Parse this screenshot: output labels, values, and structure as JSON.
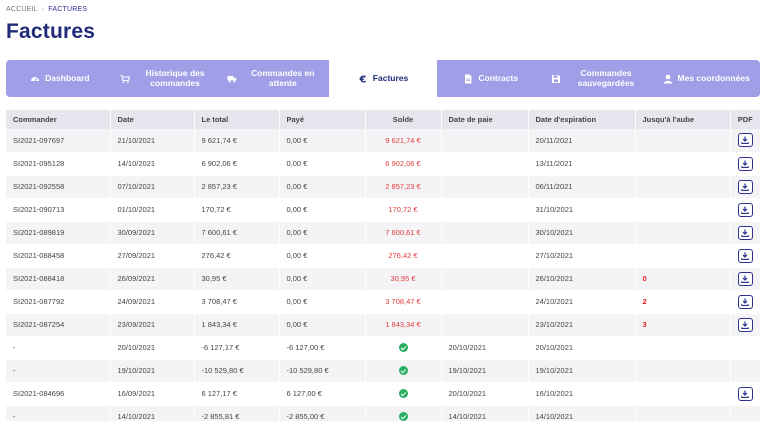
{
  "breadcrumb": {
    "home": "ACCUEIL",
    "separator": "›",
    "current": "FACTURES"
  },
  "page_title": "Factures",
  "colors": {
    "accent": "#222a7a",
    "tab_bg": "#9f9ee6",
    "negative": "#e03b3b",
    "paid": "#27ae60"
  },
  "tabs": [
    {
      "label": "Dashboard",
      "icon": "dashboard-icon",
      "active": false
    },
    {
      "label": "Historique des commandes",
      "icon": "cart-icon",
      "active": false
    },
    {
      "label": "Commandes en attente",
      "icon": "truck-icon",
      "active": false
    },
    {
      "label": "Factures",
      "icon": "euro-icon",
      "active": true
    },
    {
      "label": "Contracts",
      "icon": "document-icon",
      "active": false
    },
    {
      "label": "Commandes sauvegardées",
      "icon": "save-icon",
      "active": false
    },
    {
      "label": "Mes coordonnées",
      "icon": "user-icon",
      "active": false
    }
  ],
  "table": {
    "columns": [
      "Commander",
      "Date",
      "Le total",
      "Payé",
      "Solde",
      "Date de paie",
      "Date d'expiration",
      "Jusqu'à l'aube",
      "PDF"
    ],
    "rows": [
      {
        "commander": "SI2021-097697",
        "date": "21/10/2021",
        "total": "9 621,74 €",
        "paye": "0,00 €",
        "solde": "9 621,74 €",
        "paid": false,
        "date_paie": "",
        "date_exp": "20/11/2021",
        "jusqua": "",
        "pdf": true
      },
      {
        "commander": "SI2021-095128",
        "date": "14/10/2021",
        "total": "6 902,06 €",
        "paye": "0,00 €",
        "solde": "6 902,06 €",
        "paid": false,
        "date_paie": "",
        "date_exp": "13/11/2021",
        "jusqua": "",
        "pdf": true
      },
      {
        "commander": "SI2021-092558",
        "date": "07/10/2021",
        "total": "2 857,23 €",
        "paye": "0,00 €",
        "solde": "2 857,23 €",
        "paid": false,
        "date_paie": "",
        "date_exp": "06/11/2021",
        "jusqua": "",
        "pdf": true
      },
      {
        "commander": "SI2021-090713",
        "date": "01/10/2021",
        "total": "170,72 €",
        "paye": "0,00 €",
        "solde": "170,72 €",
        "paid": false,
        "date_paie": "",
        "date_exp": "31/10/2021",
        "jusqua": "",
        "pdf": true
      },
      {
        "commander": "SI2021-089819",
        "date": "30/09/2021",
        "total": "7 600,61 €",
        "paye": "0,00 €",
        "solde": "7 600,61 €",
        "paid": false,
        "date_paie": "",
        "date_exp": "30/10/2021",
        "jusqua": "",
        "pdf": true
      },
      {
        "commander": "SI2021-088458",
        "date": "27/09/2021",
        "total": "276,42 €",
        "paye": "0,00 €",
        "solde": "276,42 €",
        "paid": false,
        "date_paie": "",
        "date_exp": "27/10/2021",
        "jusqua": "",
        "pdf": true
      },
      {
        "commander": "SI2021-088418",
        "date": "26/09/2021",
        "total": "30,95 €",
        "paye": "0,00 €",
        "solde": "30,95 €",
        "paid": false,
        "date_paie": "",
        "date_exp": "26/10/2021",
        "jusqua": "0",
        "pdf": true
      },
      {
        "commander": "SI2021-087792",
        "date": "24/09/2021",
        "total": "3 708,47 €",
        "paye": "0,00 €",
        "solde": "3 708,47 €",
        "paid": false,
        "date_paie": "",
        "date_exp": "24/10/2021",
        "jusqua": "2",
        "pdf": true
      },
      {
        "commander": "SI2021-087254",
        "date": "23/09/2021",
        "total": "1 843,34 €",
        "paye": "0,00 €",
        "solde": "1 843,34 €",
        "paid": false,
        "date_paie": "",
        "date_exp": "23/10/2021",
        "jusqua": "3",
        "pdf": true
      },
      {
        "commander": "-",
        "date": "20/10/2021",
        "total": "-6 127,17 €",
        "paye": "-6 127,00 €",
        "solde": "",
        "paid": true,
        "date_paie": "20/10/2021",
        "date_exp": "20/10/2021",
        "jusqua": "",
        "pdf": false
      },
      {
        "commander": "-",
        "date": "19/10/2021",
        "total": "-10 529,80 €",
        "paye": "-10 529,80 €",
        "solde": "",
        "paid": true,
        "date_paie": "19/10/2021",
        "date_exp": "19/10/2021",
        "jusqua": "",
        "pdf": false
      },
      {
        "commander": "SI2021-084696",
        "date": "16/09/2021",
        "total": "6 127,17 €",
        "paye": "6 127,00 €",
        "solde": "",
        "paid": true,
        "date_paie": "20/10/2021",
        "date_exp": "16/10/2021",
        "jusqua": "",
        "pdf": true
      },
      {
        "commander": "-",
        "date": "14/10/2021",
        "total": "-2 855,81 €",
        "paye": "-2 855,00 €",
        "solde": "",
        "paid": true,
        "date_paie": "14/10/2021",
        "date_exp": "14/10/2021",
        "jusqua": "",
        "pdf": false
      }
    ]
  }
}
